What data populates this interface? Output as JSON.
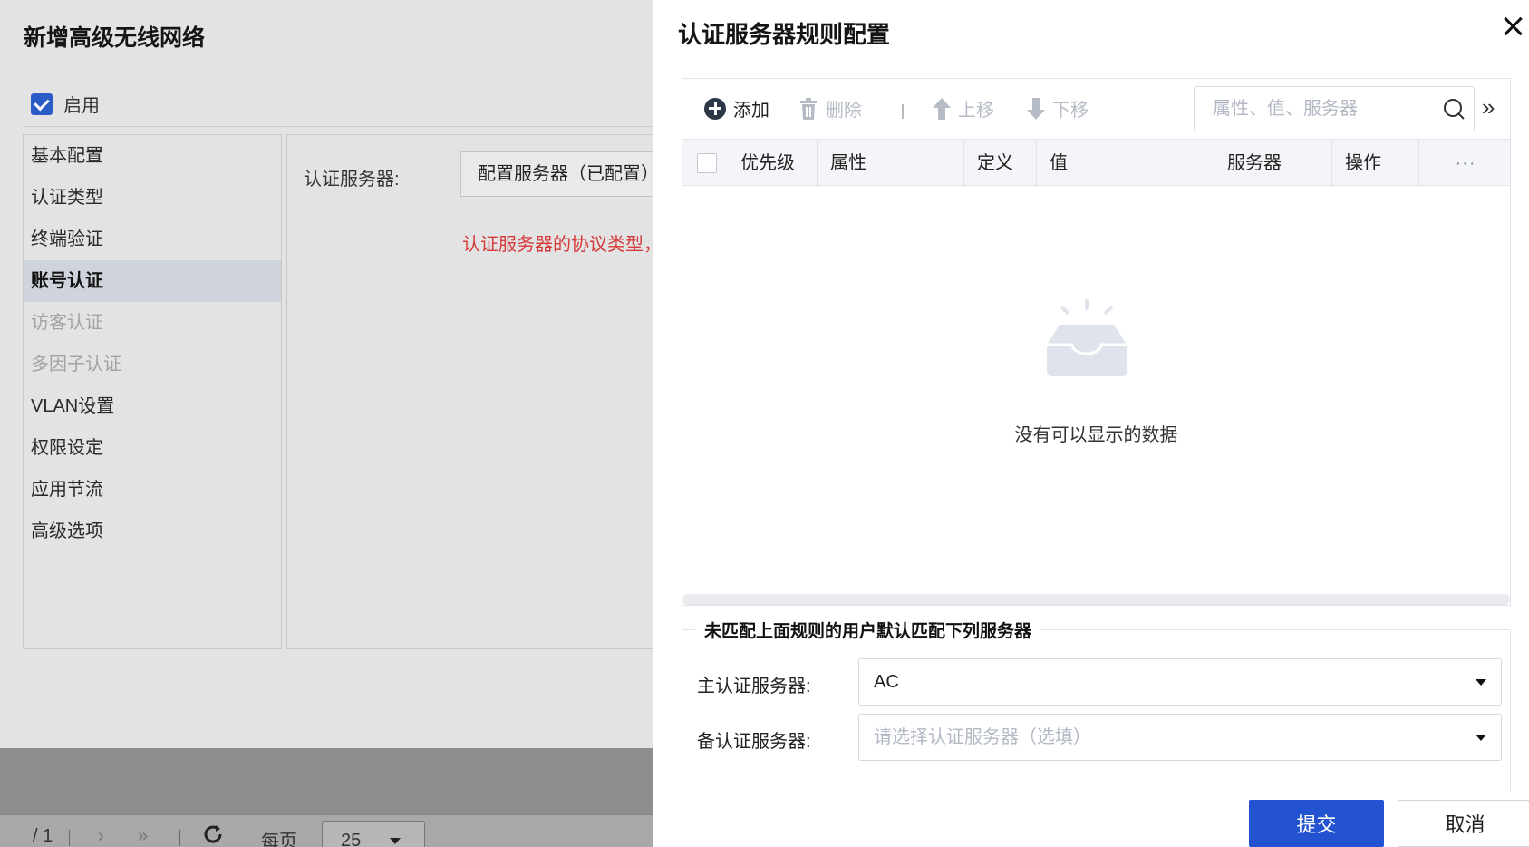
{
  "background_page": {
    "pager": {
      "page_total": "/ 1",
      "next_label": "›",
      "last_label": "»",
      "refresh_icon": "refresh-icon",
      "per_page_label": "每页",
      "per_page_value": "25"
    }
  },
  "left_dialog": {
    "title": "新增高级无线网络",
    "enable_label": "启用",
    "enable_checked": true,
    "nav": [
      {
        "label": "基本配置",
        "state": "normal"
      },
      {
        "label": "认证类型",
        "state": "normal"
      },
      {
        "label": "终端验证",
        "state": "normal"
      },
      {
        "label": "账号认证",
        "state": "active"
      },
      {
        "label": "访客认证",
        "state": "disabled"
      },
      {
        "label": "多因子认证",
        "state": "disabled"
      },
      {
        "label": "VLAN设置",
        "state": "normal"
      },
      {
        "label": "权限设定",
        "state": "normal"
      },
      {
        "label": "应用节流",
        "state": "normal"
      },
      {
        "label": "高级选项",
        "state": "normal"
      }
    ],
    "auth_server_label": "认证服务器:",
    "auth_server_value": "配置服务器（已配置）",
    "protocol_warning": "认证服务器的协议类型，"
  },
  "drawer": {
    "title": "认证服务器规则配置",
    "close_icon": "close-icon",
    "toolbar": {
      "add_label": "添加",
      "delete_label": "删除",
      "move_up_label": "上移",
      "move_down_label": "下移",
      "search_placeholder": "属性、值、服务器",
      "expand_icon": "double-chevron-right-icon"
    },
    "table": {
      "columns": [
        "优先级",
        "属性",
        "定义",
        "值",
        "服务器",
        "操作"
      ],
      "more_icon": "more-icon",
      "rows": [],
      "empty_text": "没有可以显示的数据"
    },
    "default_servers": {
      "legend": "未匹配上面规则的用户默认匹配下列服务器",
      "primary_label": "主认证服务器:",
      "primary_value": "AC",
      "backup_label": "备认证服务器:",
      "backup_placeholder": "请选择认证服务器（选填）"
    },
    "submit_label": "提交",
    "cancel_label": "取消"
  },
  "colors": {
    "primary": "#2453d1",
    "warning": "#d63a3a",
    "active_nav_bg": "#cfd4dc",
    "overlay": "#8e8e8e"
  }
}
